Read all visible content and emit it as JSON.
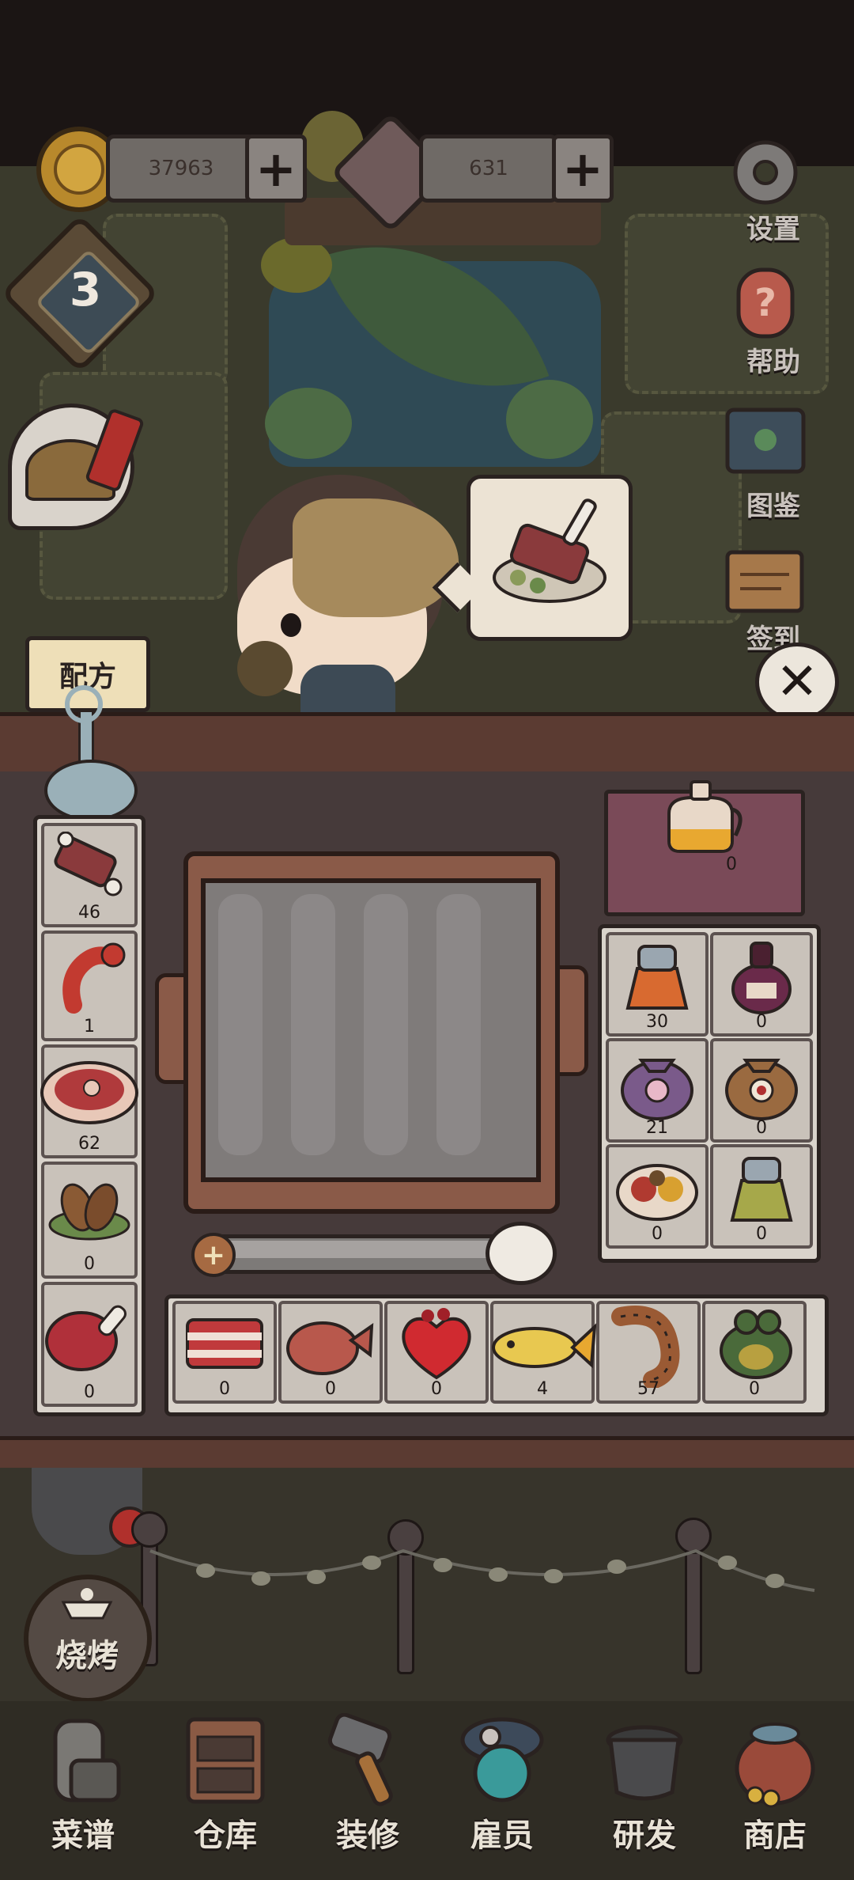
{
  "currency": {
    "coins": "37963",
    "gems": "631",
    "plus_label": "+"
  },
  "level": "3",
  "side_menu": {
    "settings": "设置",
    "help": "帮助",
    "catalog": "图鉴",
    "checkin": "签到"
  },
  "recipe_sign": "配方",
  "close_label": "✕",
  "slider": {
    "plus_label": "+"
  },
  "left_column": [
    {
      "icon": "ribs-icon",
      "count": "46"
    },
    {
      "icon": "lobster-icon",
      "count": "1"
    },
    {
      "icon": "steak-icon",
      "count": "62"
    },
    {
      "icon": "potato-icon",
      "count": "0"
    },
    {
      "icon": "ham-leg-icon",
      "count": "0"
    }
  ],
  "oil": {
    "icon": "oil-jug-icon",
    "count": "0"
  },
  "seasonings": [
    {
      "icon": "pepper-shaker-icon",
      "count": "30"
    },
    {
      "icon": "sauce-bottle-icon",
      "count": "0"
    },
    {
      "icon": "spice-bag-purple-icon",
      "count": "21"
    },
    {
      "icon": "spice-bag-brown-icon",
      "count": "0"
    },
    {
      "icon": "spice-plate-icon",
      "count": "0"
    },
    {
      "icon": "green-shaker-icon",
      "count": "0"
    }
  ],
  "bottom_row": [
    {
      "icon": "pork-belly-icon",
      "count": "0"
    },
    {
      "icon": "chop-icon",
      "count": "0"
    },
    {
      "icon": "heart-meat-icon",
      "count": "0"
    },
    {
      "icon": "fish-icon",
      "count": "4"
    },
    {
      "icon": "shrimp-icon",
      "count": "57"
    },
    {
      "icon": "frog-icon",
      "count": "0"
    }
  ],
  "bbq_button": "烧烤",
  "nav": [
    {
      "label": "菜谱",
      "icon": "recipe-book-icon"
    },
    {
      "label": "仓库",
      "icon": "warehouse-icon"
    },
    {
      "label": "装修",
      "icon": "hammer-icon"
    },
    {
      "label": "雇员",
      "icon": "employee-icon"
    },
    {
      "label": "研发",
      "icon": "pot-icon"
    },
    {
      "label": "商店",
      "icon": "shop-bag-icon"
    }
  ],
  "colors": {
    "counter": "#463a3a",
    "wood": "#5b3b32",
    "panel": "#d9d3cb",
    "grill": "#8a5a48"
  }
}
